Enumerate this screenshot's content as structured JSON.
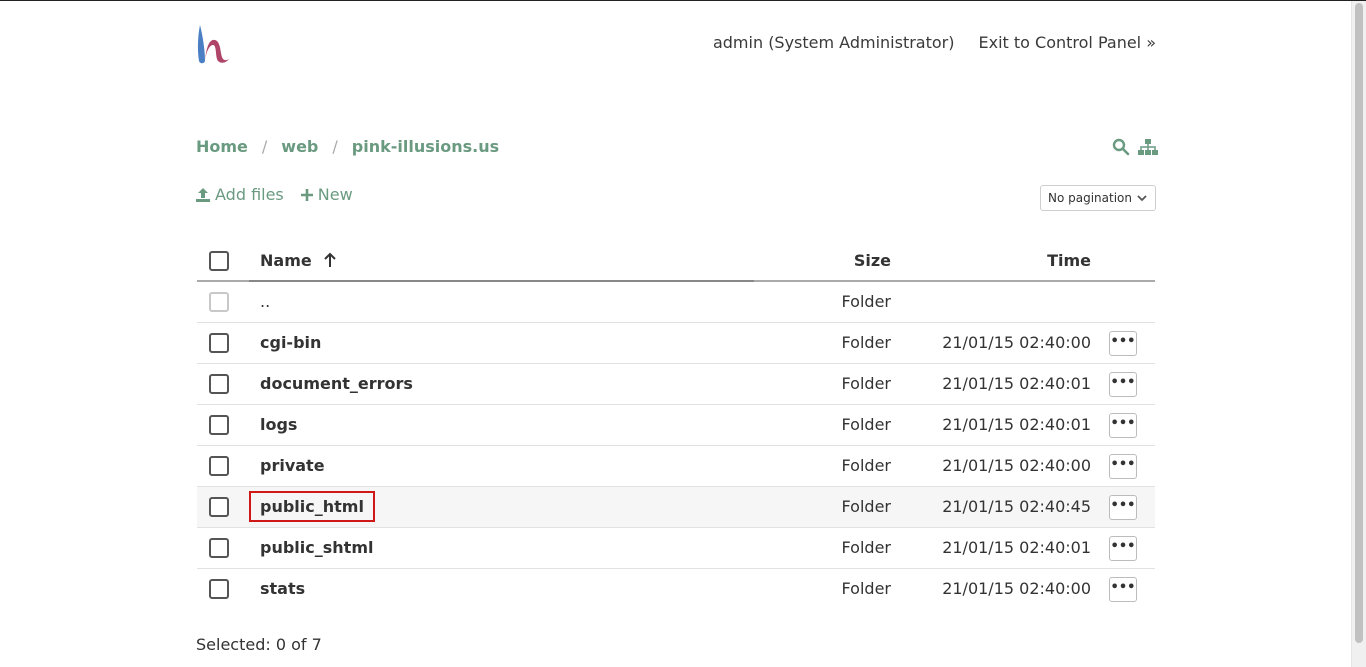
{
  "header": {
    "user_label": "admin (System Administrator)",
    "exit_label": "Exit to Control Panel »"
  },
  "breadcrumb": {
    "items": [
      "Home",
      "web",
      "pink-illusions.us"
    ],
    "separator": "/"
  },
  "toolbar": {
    "add_files_label": "Add files",
    "new_label": "New",
    "pagination_value": "No pagination"
  },
  "table": {
    "headers": {
      "name": "Name",
      "size": "Size",
      "time": "Time"
    },
    "parent_row": {
      "name": "..",
      "size": "Folder"
    },
    "rows": [
      {
        "name": "cgi-bin",
        "size": "Folder",
        "time": "21/01/15 02:40:00",
        "menu": "•••"
      },
      {
        "name": "document_errors",
        "size": "Folder",
        "time": "21/01/15 02:40:01",
        "menu": "•••"
      },
      {
        "name": "logs",
        "size": "Folder",
        "time": "21/01/15 02:40:01",
        "menu": "•••"
      },
      {
        "name": "private",
        "size": "Folder",
        "time": "21/01/15 02:40:00",
        "menu": "•••"
      },
      {
        "name": "public_html",
        "size": "Folder",
        "time": "21/01/15 02:40:45",
        "menu": "•••"
      },
      {
        "name": "public_shtml",
        "size": "Folder",
        "time": "21/01/15 02:40:01",
        "menu": "•••"
      },
      {
        "name": "stats",
        "size": "Folder",
        "time": "21/01/15 02:40:00",
        "menu": "•••"
      }
    ]
  },
  "status": {
    "selected_text": "Selected: 0 of 7"
  },
  "colors": {
    "accent": "#6a9a80",
    "highlight": "#d01818"
  }
}
